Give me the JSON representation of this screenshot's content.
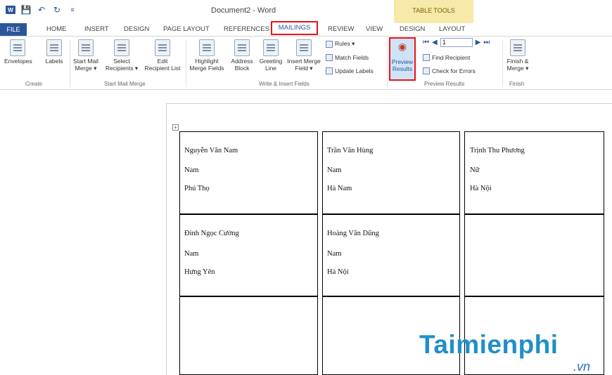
{
  "window": {
    "title": "Document2 - Word",
    "table_tools_label": "TABLE TOOLS"
  },
  "tabs": {
    "file": "FILE",
    "home": "HOME",
    "insert": "INSERT",
    "design": "DESIGN",
    "page_layout": "PAGE LAYOUT",
    "references": "REFERENCES",
    "mailings": "MAILINGS",
    "review": "REVIEW",
    "view": "VIEW",
    "tt_design": "DESIGN",
    "tt_layout": "LAYOUT"
  },
  "ribbon": {
    "create": {
      "label": "Create",
      "envelopes": "Envelopes",
      "labels": "Labels"
    },
    "start_mail_merge": {
      "label": "Start Mail Merge",
      "start_line1": "Start Mail",
      "start_line2": "Merge ▾",
      "select_line1": "Select",
      "select_line2": "Recipients ▾",
      "edit_line1": "Edit",
      "edit_line2": "Recipient List"
    },
    "write_insert": {
      "label": "Write & Insert Fields",
      "highlight_line1": "Highlight",
      "highlight_line2": "Merge Fields",
      "address_line1": "Address",
      "address_line2": "Block",
      "greeting_line1": "Greeting",
      "greeting_line2": "Line",
      "insert_line1": "Insert Merge",
      "insert_line2": "Field ▾",
      "rules": "Rules ▾",
      "match_fields": "Match Fields",
      "update_labels": "Update Labels"
    },
    "preview_results": {
      "label": "Preview Results",
      "preview_line1": "Preview",
      "preview_line2": "Results",
      "record_value": "1",
      "find_recipient": "Find Recipient",
      "check_errors": "Check for Errors"
    },
    "finish": {
      "label": "Finish",
      "finish_line1": "Finish &",
      "finish_line2": "Merge ▾"
    }
  },
  "labels": [
    {
      "name": "Nguyễn Văn Nam",
      "gender": "Nam",
      "place": "Phú Thọ"
    },
    {
      "name": "Trần Văn Hùng",
      "gender": "Nam",
      "place": "Hà Nam"
    },
    {
      "name": "Trịnh Thu Phương",
      "gender": "Nữ",
      "place": "Hà Nội"
    },
    {
      "name": "Đinh Ngọc Cường",
      "gender": "Nam",
      "place": "Hưng Yên"
    },
    {
      "name": "Hoàng Văn Dũng",
      "gender": "Nam",
      "place": "Hà Nội"
    }
  ],
  "watermark": {
    "main": "Taimienphi",
    "sub": ".vn"
  }
}
